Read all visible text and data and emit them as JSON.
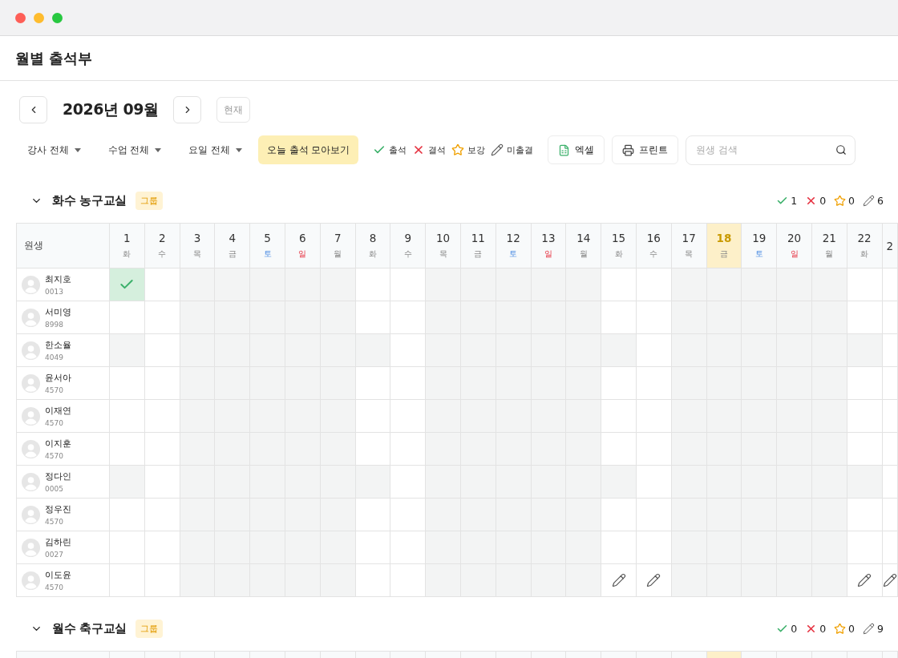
{
  "window": {
    "controls": [
      {
        "kind": "close"
      },
      {
        "kind": "minimize"
      },
      {
        "kind": "zoom"
      }
    ]
  },
  "page_title": "월별 출석부",
  "month_nav": {
    "label": "2026년 09월",
    "today_button": "현재"
  },
  "filters": [
    {
      "label": "강사 전체"
    },
    {
      "label": "수업 전체"
    },
    {
      "label": "요일 전체"
    }
  ],
  "today_button": "오늘 출석 모아보기",
  "legend": [
    {
      "kind": "present",
      "label": "출석"
    },
    {
      "kind": "absent",
      "label": "결석"
    },
    {
      "kind": "makeup",
      "label": "보강"
    },
    {
      "kind": "pending",
      "label": "미출결"
    }
  ],
  "actions": [
    {
      "kind": "excel",
      "label": "엑셀"
    },
    {
      "kind": "print",
      "label": "프린트"
    }
  ],
  "search": {
    "placeholder": "원생 검색"
  },
  "student_column": "원생",
  "days": [
    {
      "date": "1",
      "weekday": "화",
      "kind": "weekday",
      "selected": false
    },
    {
      "date": "2",
      "weekday": "수",
      "kind": "weekday",
      "selected": false
    },
    {
      "date": "3",
      "weekday": "목",
      "kind": "weekday",
      "selected": false
    },
    {
      "date": "4",
      "weekday": "금",
      "kind": "weekday",
      "selected": false
    },
    {
      "date": "5",
      "weekday": "토",
      "kind": "saturday",
      "selected": false
    },
    {
      "date": "6",
      "weekday": "일",
      "kind": "sunday",
      "selected": false
    },
    {
      "date": "7",
      "weekday": "월",
      "kind": "weekday",
      "selected": false
    },
    {
      "date": "8",
      "weekday": "화",
      "kind": "weekday",
      "selected": false
    },
    {
      "date": "9",
      "weekday": "수",
      "kind": "weekday",
      "selected": false
    },
    {
      "date": "10",
      "weekday": "목",
      "kind": "weekday",
      "selected": false
    },
    {
      "date": "11",
      "weekday": "금",
      "kind": "weekday",
      "selected": false
    },
    {
      "date": "12",
      "weekday": "토",
      "kind": "saturday",
      "selected": false
    },
    {
      "date": "13",
      "weekday": "일",
      "kind": "sunday",
      "selected": false
    },
    {
      "date": "14",
      "weekday": "월",
      "kind": "weekday",
      "selected": false
    },
    {
      "date": "15",
      "weekday": "화",
      "kind": "weekday",
      "selected": false
    },
    {
      "date": "16",
      "weekday": "수",
      "kind": "weekday",
      "selected": false
    },
    {
      "date": "17",
      "weekday": "목",
      "kind": "weekday",
      "selected": false
    },
    {
      "date": "18",
      "weekday": "금",
      "kind": "weekday",
      "selected": true
    },
    {
      "date": "19",
      "weekday": "토",
      "kind": "saturday",
      "selected": false
    },
    {
      "date": "20",
      "weekday": "일",
      "kind": "sunday",
      "selected": false
    },
    {
      "date": "21",
      "weekday": "월",
      "kind": "weekday",
      "selected": false
    },
    {
      "date": "22",
      "weekday": "화",
      "kind": "weekday",
      "selected": false
    },
    {
      "date": "2",
      "selected": false
    }
  ],
  "groups": [
    {
      "title": "화수 농구교실",
      "badge": "그룹",
      "expanded": true,
      "summary": [
        {
          "kind": "present",
          "count": "1"
        },
        {
          "kind": "absent",
          "count": "0"
        },
        {
          "kind": "makeup",
          "count": "0"
        },
        {
          "kind": "pending",
          "count": "6"
        }
      ],
      "rows": [
        {
          "name": "최지호",
          "code": "0013",
          "cells": [
            {
              "kind": "present"
            },
            {
              "kind": "open"
            },
            {
              "kind": "off"
            },
            {
              "kind": "off"
            },
            {
              "kind": "off"
            },
            {
              "kind": "off"
            },
            {
              "kind": "off"
            },
            {
              "kind": "open"
            },
            {
              "kind": "open"
            },
            {
              "kind": "off"
            },
            {
              "kind": "off"
            },
            {
              "kind": "off"
            },
            {
              "kind": "off"
            },
            {
              "kind": "off"
            },
            {
              "kind": "open"
            },
            {
              "kind": "open"
            },
            {
              "kind": "off"
            },
            {
              "kind": "off"
            },
            {
              "kind": "off"
            },
            {
              "kind": "off"
            },
            {
              "kind": "off"
            },
            {
              "kind": "open"
            },
            {
              "kind": "open"
            }
          ]
        },
        {
          "name": "서미영",
          "code": "8998",
          "cells": [
            {
              "kind": "open"
            },
            {
              "kind": "open"
            },
            {
              "kind": "off"
            },
            {
              "kind": "off"
            },
            {
              "kind": "off"
            },
            {
              "kind": "off"
            },
            {
              "kind": "off"
            },
            {
              "kind": "open"
            },
            {
              "kind": "open"
            },
            {
              "kind": "off"
            },
            {
              "kind": "off"
            },
            {
              "kind": "off"
            },
            {
              "kind": "off"
            },
            {
              "kind": "off"
            },
            {
              "kind": "open"
            },
            {
              "kind": "open"
            },
            {
              "kind": "off"
            },
            {
              "kind": "off"
            },
            {
              "kind": "off"
            },
            {
              "kind": "off"
            },
            {
              "kind": "off"
            },
            {
              "kind": "open"
            },
            {
              "kind": "open"
            }
          ]
        },
        {
          "name": "한소율",
          "code": "4049",
          "cells": [
            {
              "kind": "off"
            },
            {
              "kind": "open"
            },
            {
              "kind": "off"
            },
            {
              "kind": "off"
            },
            {
              "kind": "off"
            },
            {
              "kind": "off"
            },
            {
              "kind": "off"
            },
            {
              "kind": "off"
            },
            {
              "kind": "open"
            },
            {
              "kind": "off"
            },
            {
              "kind": "off"
            },
            {
              "kind": "off"
            },
            {
              "kind": "off"
            },
            {
              "kind": "off"
            },
            {
              "kind": "off"
            },
            {
              "kind": "open"
            },
            {
              "kind": "off"
            },
            {
              "kind": "off"
            },
            {
              "kind": "off"
            },
            {
              "kind": "off"
            },
            {
              "kind": "off"
            },
            {
              "kind": "off"
            },
            {
              "kind": "open"
            }
          ]
        },
        {
          "name": "윤서아",
          "code": "4570",
          "cells": [
            {
              "kind": "open"
            },
            {
              "kind": "open"
            },
            {
              "kind": "off"
            },
            {
              "kind": "off"
            },
            {
              "kind": "off"
            },
            {
              "kind": "off"
            },
            {
              "kind": "off"
            },
            {
              "kind": "open"
            },
            {
              "kind": "open"
            },
            {
              "kind": "off"
            },
            {
              "kind": "off"
            },
            {
              "kind": "off"
            },
            {
              "kind": "off"
            },
            {
              "kind": "off"
            },
            {
              "kind": "open"
            },
            {
              "kind": "open"
            },
            {
              "kind": "off"
            },
            {
              "kind": "off"
            },
            {
              "kind": "off"
            },
            {
              "kind": "off"
            },
            {
              "kind": "off"
            },
            {
              "kind": "open"
            },
            {
              "kind": "open"
            }
          ]
        },
        {
          "name": "이재연",
          "code": "4570",
          "cells": [
            {
              "kind": "open"
            },
            {
              "kind": "open"
            },
            {
              "kind": "off"
            },
            {
              "kind": "off"
            },
            {
              "kind": "off"
            },
            {
              "kind": "off"
            },
            {
              "kind": "off"
            },
            {
              "kind": "open"
            },
            {
              "kind": "open"
            },
            {
              "kind": "off"
            },
            {
              "kind": "off"
            },
            {
              "kind": "off"
            },
            {
              "kind": "off"
            },
            {
              "kind": "off"
            },
            {
              "kind": "open"
            },
            {
              "kind": "open"
            },
            {
              "kind": "off"
            },
            {
              "kind": "off"
            },
            {
              "kind": "off"
            },
            {
              "kind": "off"
            },
            {
              "kind": "off"
            },
            {
              "kind": "open"
            },
            {
              "kind": "open"
            }
          ]
        },
        {
          "name": "이지훈",
          "code": "4570",
          "cells": [
            {
              "kind": "open"
            },
            {
              "kind": "open"
            },
            {
              "kind": "off"
            },
            {
              "kind": "off"
            },
            {
              "kind": "off"
            },
            {
              "kind": "off"
            },
            {
              "kind": "off"
            },
            {
              "kind": "open"
            },
            {
              "kind": "open"
            },
            {
              "kind": "off"
            },
            {
              "kind": "off"
            },
            {
              "kind": "off"
            },
            {
              "kind": "off"
            },
            {
              "kind": "off"
            },
            {
              "kind": "open"
            },
            {
              "kind": "open"
            },
            {
              "kind": "off"
            },
            {
              "kind": "off"
            },
            {
              "kind": "off"
            },
            {
              "kind": "off"
            },
            {
              "kind": "off"
            },
            {
              "kind": "open"
            },
            {
              "kind": "open"
            }
          ]
        },
        {
          "name": "정다인",
          "code": "0005",
          "cells": [
            {
              "kind": "off"
            },
            {
              "kind": "open"
            },
            {
              "kind": "off"
            },
            {
              "kind": "off"
            },
            {
              "kind": "off"
            },
            {
              "kind": "off"
            },
            {
              "kind": "off"
            },
            {
              "kind": "off"
            },
            {
              "kind": "open"
            },
            {
              "kind": "off"
            },
            {
              "kind": "off"
            },
            {
              "kind": "off"
            },
            {
              "kind": "off"
            },
            {
              "kind": "off"
            },
            {
              "kind": "off"
            },
            {
              "kind": "open"
            },
            {
              "kind": "off"
            },
            {
              "kind": "off"
            },
            {
              "kind": "off"
            },
            {
              "kind": "off"
            },
            {
              "kind": "off"
            },
            {
              "kind": "off"
            },
            {
              "kind": "open"
            }
          ]
        },
        {
          "name": "정우진",
          "code": "4570",
          "cells": [
            {
              "kind": "open"
            },
            {
              "kind": "open"
            },
            {
              "kind": "off"
            },
            {
              "kind": "off"
            },
            {
              "kind": "off"
            },
            {
              "kind": "off"
            },
            {
              "kind": "off"
            },
            {
              "kind": "open"
            },
            {
              "kind": "open"
            },
            {
              "kind": "off"
            },
            {
              "kind": "off"
            },
            {
              "kind": "off"
            },
            {
              "kind": "off"
            },
            {
              "kind": "off"
            },
            {
              "kind": "open"
            },
            {
              "kind": "open"
            },
            {
              "kind": "off"
            },
            {
              "kind": "off"
            },
            {
              "kind": "off"
            },
            {
              "kind": "off"
            },
            {
              "kind": "off"
            },
            {
              "kind": "open"
            },
            {
              "kind": "open"
            }
          ]
        },
        {
          "name": "김하린",
          "code": "0027",
          "cells": [
            {
              "kind": "open"
            },
            {
              "kind": "open"
            },
            {
              "kind": "off"
            },
            {
              "kind": "off"
            },
            {
              "kind": "off"
            },
            {
              "kind": "off"
            },
            {
              "kind": "off"
            },
            {
              "kind": "open"
            },
            {
              "kind": "open"
            },
            {
              "kind": "off"
            },
            {
              "kind": "off"
            },
            {
              "kind": "off"
            },
            {
              "kind": "off"
            },
            {
              "kind": "off"
            },
            {
              "kind": "open"
            },
            {
              "kind": "open"
            },
            {
              "kind": "off"
            },
            {
              "kind": "off"
            },
            {
              "kind": "off"
            },
            {
              "kind": "off"
            },
            {
              "kind": "off"
            },
            {
              "kind": "open"
            },
            {
              "kind": "open"
            }
          ]
        },
        {
          "name": "이도윤",
          "code": "4570",
          "cells": [
            {
              "kind": "open"
            },
            {
              "kind": "open"
            },
            {
              "kind": "off"
            },
            {
              "kind": "off"
            },
            {
              "kind": "off"
            },
            {
              "kind": "off"
            },
            {
              "kind": "off"
            },
            {
              "kind": "open"
            },
            {
              "kind": "open"
            },
            {
              "kind": "off"
            },
            {
              "kind": "off"
            },
            {
              "kind": "off"
            },
            {
              "kind": "off"
            },
            {
              "kind": "off"
            },
            {
              "kind": "pending"
            },
            {
              "kind": "pending"
            },
            {
              "kind": "off"
            },
            {
              "kind": "off"
            },
            {
              "kind": "off"
            },
            {
              "kind": "off"
            },
            {
              "kind": "off"
            },
            {
              "kind": "pending"
            },
            {
              "kind": "pending"
            }
          ]
        }
      ]
    },
    {
      "title": "월수 축구교실",
      "badge": "그룹",
      "expanded": true,
      "summary": [
        {
          "kind": "present",
          "count": "0"
        },
        {
          "kind": "absent",
          "count": "0"
        },
        {
          "kind": "makeup",
          "count": "0"
        },
        {
          "kind": "pending",
          "count": "9"
        }
      ]
    }
  ]
}
